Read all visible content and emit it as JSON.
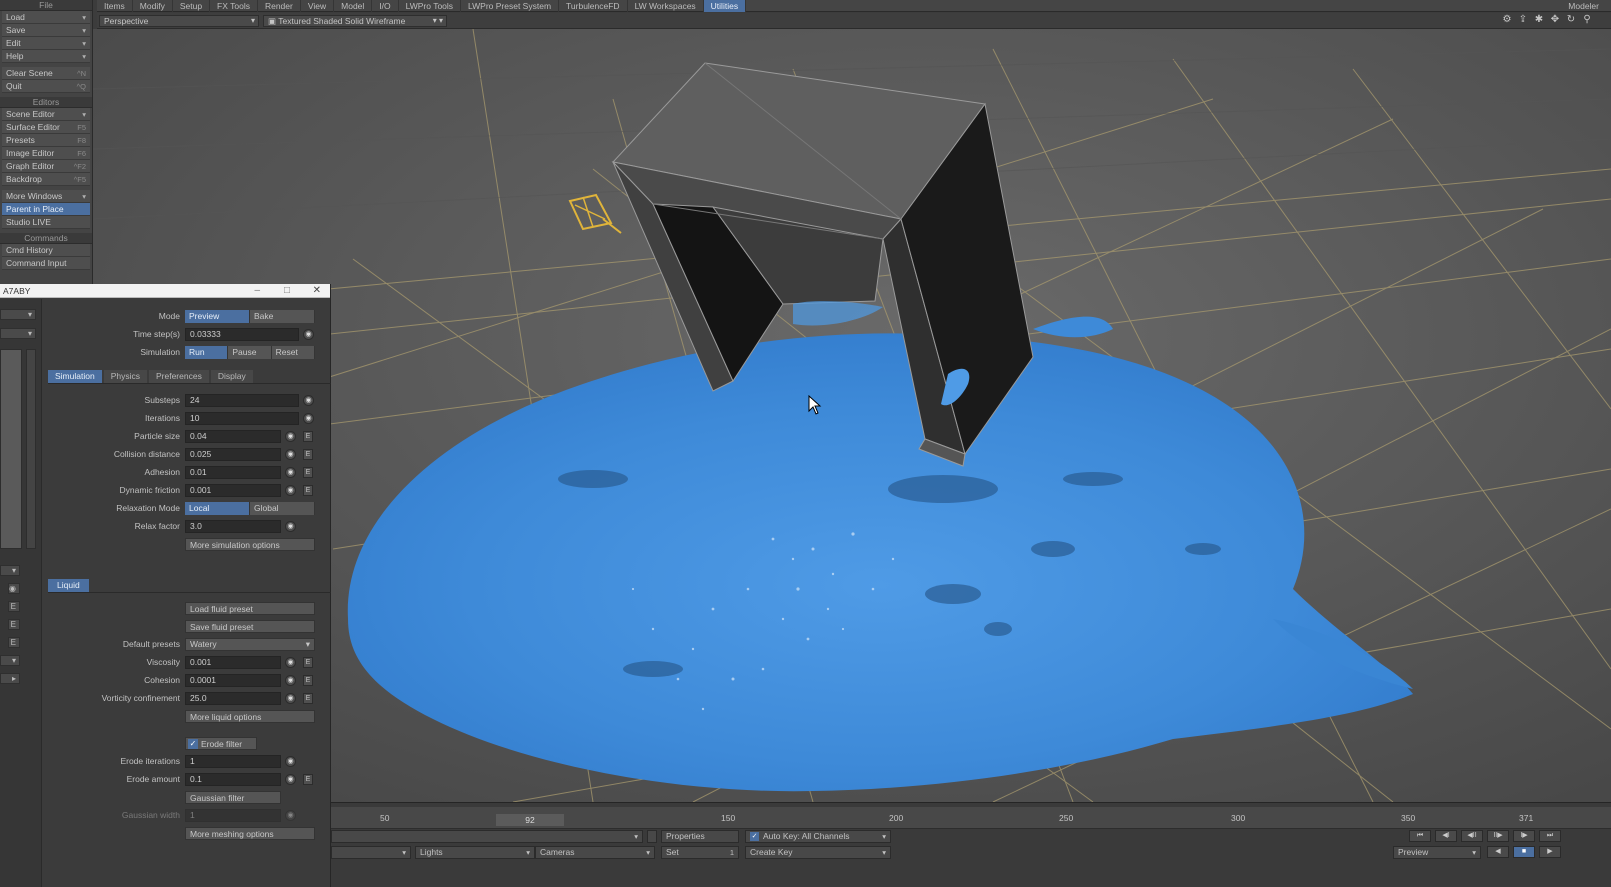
{
  "menubar": {
    "items": [
      "Items",
      "Modify",
      "Setup",
      "FX Tools",
      "Render",
      "View",
      "Model",
      "I/O",
      "LWPro Tools",
      "LWPro Preset System",
      "TurbulenceFD",
      "LW Workspaces",
      "Utilities"
    ],
    "active": "Utilities",
    "right": "Modeler"
  },
  "viewbar": {
    "view_mode": "Perspective",
    "shading_mode": "Textured Shaded Solid Wireframe",
    "icons": [
      "gear-icon",
      "export-icon",
      "settings-icon",
      "move-icon",
      "rotate-icon",
      "zoom-icon"
    ]
  },
  "left_toolbar": {
    "file_header": "File",
    "file_items": [
      {
        "label": "Load",
        "dd": "▾"
      },
      {
        "label": "Save",
        "dd": "▾"
      },
      {
        "label": "Edit",
        "dd": "▾"
      },
      {
        "label": "Help",
        "dd": "▾"
      }
    ],
    "scene_items": [
      {
        "label": "Clear Scene",
        "shortcut": "^N"
      },
      {
        "label": "Quit",
        "shortcut": "^Q"
      }
    ],
    "editors_header": "Editors",
    "editor_items": [
      {
        "label": "Scene Editor",
        "dd": "▾"
      },
      {
        "label": "Surface Editor",
        "shortcut": "F5"
      },
      {
        "label": "Presets",
        "shortcut": "F8"
      },
      {
        "label": "Image Editor",
        "shortcut": "F6"
      },
      {
        "label": "Graph Editor",
        "shortcut": "^F2"
      },
      {
        "label": "Backdrop",
        "shortcut": "^F5"
      }
    ],
    "windows_items": [
      {
        "label": "More Windows",
        "dd": "▾"
      },
      {
        "label": "Parent in Place",
        "highlight": true
      },
      {
        "label": "Studio LIVE"
      }
    ],
    "commands_header": "Commands",
    "command_items": [
      {
        "label": "Cmd History"
      },
      {
        "label": "Command Input"
      }
    ]
  },
  "panel": {
    "title": "A7ABY",
    "mode": {
      "label": "Mode",
      "options": [
        "Preview",
        "Bake"
      ],
      "active": 0
    },
    "time_step": {
      "label": "Time step(s)",
      "value": "0.03333"
    },
    "simulation": {
      "label": "Simulation",
      "options": [
        "Run",
        "Pause",
        "Reset"
      ],
      "active": 0
    },
    "tabs": [
      "Simulation",
      "Physics",
      "Preferences",
      "Display"
    ],
    "active_tab": "Simulation",
    "fields": [
      {
        "label": "Substeps",
        "value": "24",
        "e": false
      },
      {
        "label": "Iterations",
        "value": "10",
        "e": false
      },
      {
        "label": "Particle size",
        "value": "0.04",
        "e": true
      },
      {
        "label": "Collision distance",
        "value": "0.025",
        "e": true
      },
      {
        "label": "Adhesion",
        "value": "0.01",
        "e": true
      },
      {
        "label": "Dynamic friction",
        "value": "0.001",
        "e": true
      }
    ],
    "relaxation": {
      "label": "Relaxation Mode",
      "options": [
        "Local",
        "Global"
      ],
      "active": 0
    },
    "relax_factor": {
      "label": "Relax factor",
      "value": "3.0"
    },
    "more_sim": "More simulation options",
    "liquid_header": "Liquid",
    "load_preset": "Load fluid preset",
    "save_preset": "Save fluid preset",
    "default_presets": {
      "label": "Default presets",
      "value": "Watery"
    },
    "liquid_fields": [
      {
        "label": "Viscosity",
        "value": "0.001"
      },
      {
        "label": "Cohesion",
        "value": "0.0001"
      },
      {
        "label": "Vorticity confinement",
        "value": "25.0"
      }
    ],
    "more_liquid": "More liquid options",
    "erode": {
      "label": "Erode filter",
      "checked": true
    },
    "erode_fields": [
      {
        "label": "Erode iterations",
        "value": "1",
        "e": false
      },
      {
        "label": "Erode amount",
        "value": "0.1",
        "e": true
      }
    ],
    "gaussian": "Gaussian filter",
    "gaussian_width": {
      "label": "Gaussian width",
      "value": "1"
    },
    "more_meshing": "More meshing options",
    "e_label": "E"
  },
  "timeline": {
    "ticks": [
      "50",
      "150",
      "200",
      "250",
      "300",
      "350",
      "371"
    ],
    "current_frame": "92",
    "properties": "Properties",
    "autokey": "Auto Key: All Channels",
    "lights": "Lights",
    "cameras": "Cameras",
    "set_label": "Set",
    "set_value": "1",
    "create_key": "Create Key",
    "preview": "Preview",
    "transport": [
      "⏮",
      "◀I",
      "◀II",
      "II▶",
      "I▶",
      "⏭"
    ]
  }
}
